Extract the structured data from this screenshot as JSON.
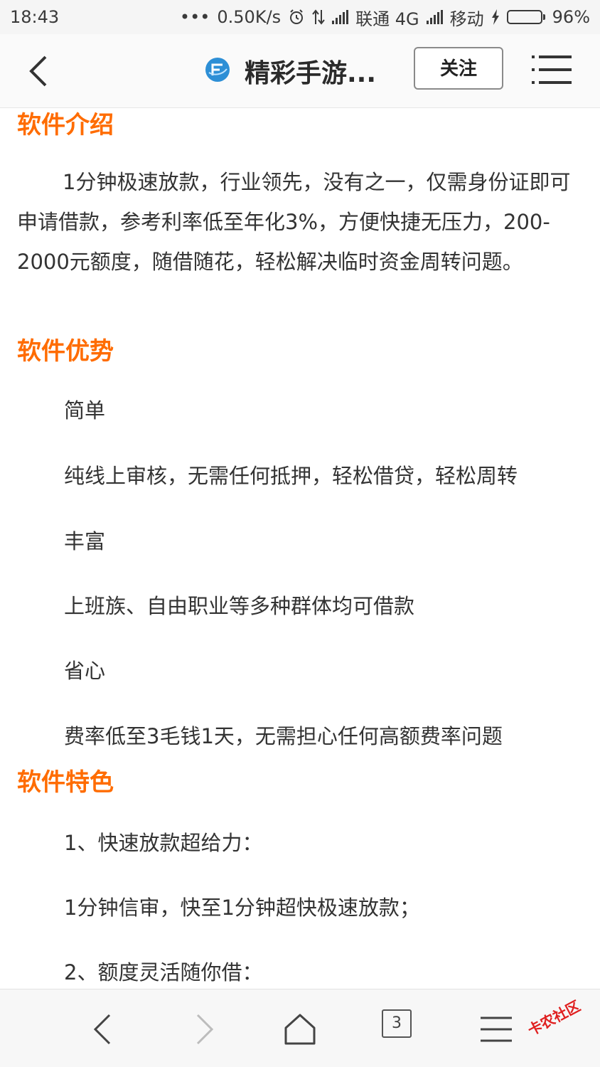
{
  "status_bar": {
    "time": "18:43",
    "dots": "•••",
    "speed": "0.50K/s",
    "carrier1": "联通 4G",
    "carrier2": "移动",
    "battery": "96%",
    "battery_level": 0.96,
    "battery_color": "#43c24a",
    "icons": [
      "alarm-icon",
      "data-arrows-icon",
      "signal-icon",
      "charging-icon",
      "battery-icon"
    ]
  },
  "title_bar": {
    "title": "精彩手游...",
    "follow_label": "关注",
    "icons": [
      "back-icon",
      "site-logo-icon",
      "menu-icon"
    ]
  },
  "article": {
    "h_intro": "软件介绍",
    "intro": "1分钟极速放款，行业领先，没有之一，仅需身份证即可申请借款，参考利率低至年化3%，方便快捷无压力，200-2000元额度，随借随花，轻松解决临时资金周转问题。",
    "h_advantage": "软件优势",
    "advantages": [
      "简单",
      "纯线上审核，无需任何抵押，轻松借贷，轻松周转",
      "丰富",
      "上班族、自由职业等多种群体均可借款",
      "省心",
      "费率低至3毛钱1天，无需担心任何高额费率问题"
    ],
    "h_features": "软件特色",
    "features": [
      "1、快速放款超给力：",
      "1分钟信审，快至1分钟超快极速放款；",
      "2、额度灵活随你借："
    ],
    "heading_color": "#ff6c00"
  },
  "bottom_nav": {
    "tab_count": "3",
    "watermark": "卡农社区",
    "icons": [
      "back-arrow-icon",
      "forward-arrow-icon",
      "home-icon",
      "tabs-icon",
      "menu-icon"
    ]
  }
}
